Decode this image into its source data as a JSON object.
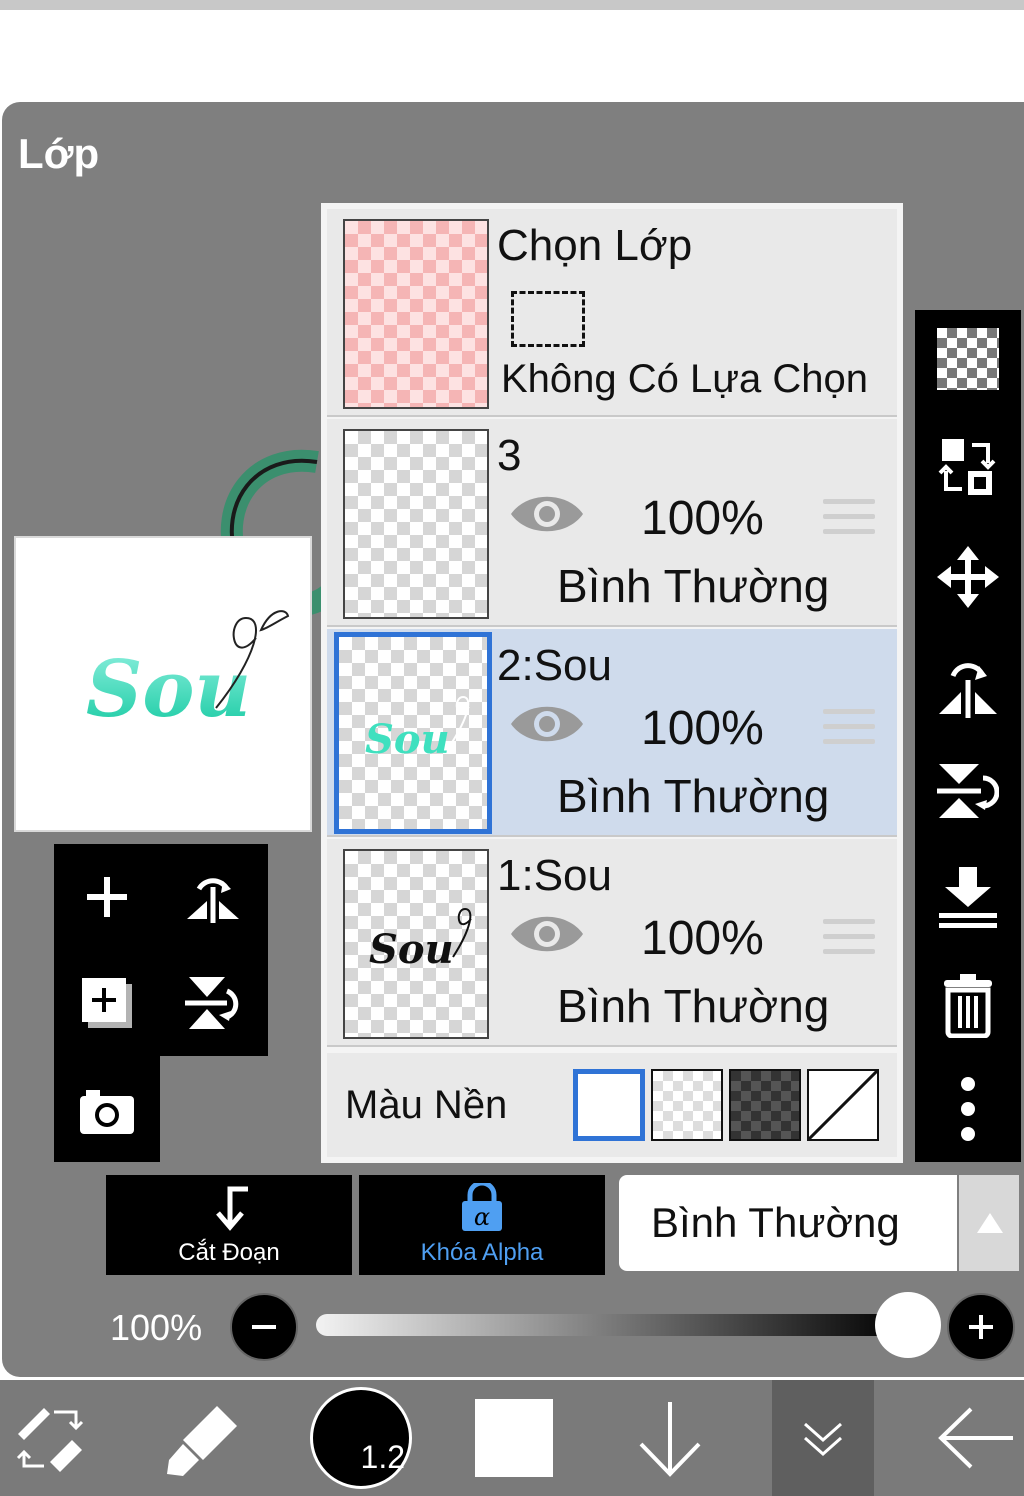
{
  "panel": {
    "title": "Lớp"
  },
  "layers": [
    {
      "name": "Chọn Lớp",
      "subtitle": "Không Có Lựa Chọn"
    },
    {
      "name": "3",
      "opacity": "100%",
      "mode": "Bình Thường",
      "visible": true
    },
    {
      "name": "2:Sou",
      "opacity": "100%",
      "mode": "Bình Thường",
      "visible": true,
      "selected": true
    },
    {
      "name": "1:Sou",
      "opacity": "100%",
      "mode": "Bình Thường",
      "visible": true
    }
  ],
  "background": {
    "label": "Màu Nền"
  },
  "actions": {
    "clip_label": "Cắt Đoạn",
    "alpha_lock_label": "Khóa Alpha"
  },
  "blend_mode": {
    "value": "Bình Thường"
  },
  "opacity_control": {
    "value": "100%",
    "level": 1.0
  },
  "bottom_toolbar": {
    "brush_size": "1.2"
  },
  "thumb_text": "Sou",
  "colors": {
    "accent": "#2f73d6",
    "selected_row": "#cfdbec",
    "alpha_lock": "#4f9ff2",
    "logo_teal": "#2fd6b0"
  }
}
